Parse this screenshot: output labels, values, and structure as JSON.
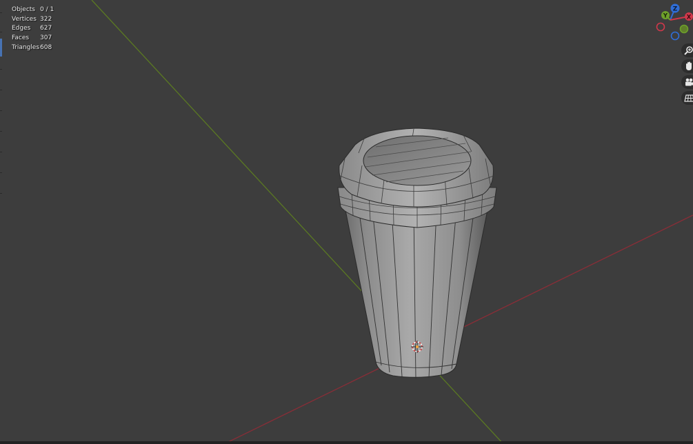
{
  "statistics": [
    {
      "label": "Objects",
      "value": "0 / 1"
    },
    {
      "label": "Vertices",
      "value": "322"
    },
    {
      "label": "Edges",
      "value": "627"
    },
    {
      "label": "Faces",
      "value": "307"
    },
    {
      "label": "Triangles",
      "value": "608"
    }
  ],
  "gizmo": {
    "axes": [
      {
        "label": "Z",
        "color": "#2f6ed8"
      },
      {
        "label": "Y",
        "color": "#6ea12a"
      },
      {
        "label": "X",
        "color": "#d1384b"
      }
    ]
  },
  "navigation_tools": [
    {
      "icon": "zoom-icon"
    },
    {
      "icon": "hand-pan-icon"
    },
    {
      "icon": "camera-icon"
    },
    {
      "icon": "grid-icon"
    }
  ],
  "colors": {
    "background": "#3d3d3d",
    "x_axis": "#8a2d37",
    "y_axis": "#5b7a22",
    "mesh": "#8c8c8c",
    "accent": "#4772b3"
  }
}
